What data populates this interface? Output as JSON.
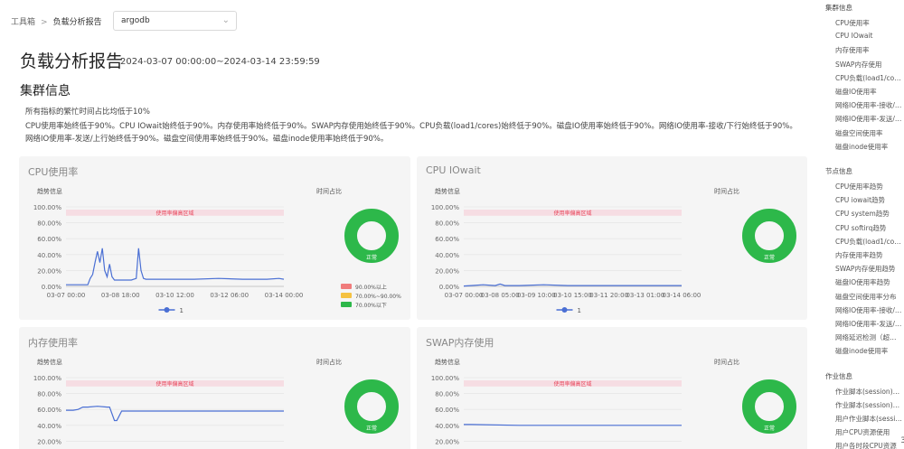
{
  "breadcrumb": {
    "root": "工具箱",
    "separator": ">",
    "current": "负载分析报告"
  },
  "cluster_select": {
    "value": "argodb"
  },
  "header": {
    "title": "负载分析报告",
    "time_range": "2024-03-07 00:00:00~2024-03-14 23:59:59"
  },
  "cluster_section": {
    "title": "集群信息",
    "summary": "所有指标的繁忙时间占比均低于10%",
    "detail": "CPU使用率始终低于90%。CPU IOwait始终低于90%。内存使用率始终低于90%。SWAP内存使用始终低于90%。CPU负载(load1/cores)始终低于90%。磁盘IO使用率始终低于90%。网络IO使用率-接收/下行始终低于90%。网络IO使用率-发送/上行始终低于90%。磁盘空间使用率始终低于90%。磁盘inode使用率始终低于90%。"
  },
  "chart_labels": {
    "trend": "趋势信息",
    "time_share": "时间占比",
    "band": "使用率偏高区域",
    "donut": "正常",
    "legend_series": "1",
    "pie_legend": [
      "90.00%以上",
      "70.00%~90.00%",
      "70.00%以下"
    ],
    "colors": {
      "high": "#f07c7c",
      "mid": "#f5c242",
      "normal": "#2db84a",
      "line": "#4a6fd4",
      "band": "#f6dde3",
      "band_text": "#e8455a"
    }
  },
  "chart_data": [
    {
      "type": "line",
      "title": "CPU使用率",
      "yticks": [
        "0.00%",
        "20.00%",
        "40.00%",
        "60.00%",
        "80.00%",
        "100.00%"
      ],
      "ylim": [
        0,
        100
      ],
      "xticks": [
        "03-07 00:00",
        "03-08 18:00",
        "03-10 12:00",
        "03-12 06:00",
        "03-14 00:00"
      ],
      "xrange_hours": [
        -6,
        174
      ],
      "band": [
        90,
        100
      ],
      "series": [
        {
          "name": "1",
          "x_hours": [
            -6,
            0,
            12,
            14,
            16,
            18,
            20,
            22,
            24,
            26,
            28,
            30,
            32,
            34,
            36,
            38,
            40,
            42,
            44,
            46,
            48,
            50,
            52,
            54,
            56,
            58,
            60,
            62,
            64,
            66,
            70,
            80,
            100,
            120,
            140,
            160,
            170,
            174
          ],
          "y": [
            2,
            2,
            2,
            10,
            15,
            30,
            44,
            30,
            48,
            20,
            12,
            28,
            12,
            8,
            8,
            8,
            8,
            8,
            8,
            8,
            8,
            9,
            10,
            48,
            20,
            10,
            9,
            9,
            9,
            9,
            9,
            9,
            9,
            10,
            9,
            9,
            10,
            9
          ]
        }
      ],
      "pie": [
        {
          "label": "90.00%以上",
          "value": 0
        },
        {
          "label": "70.00%~90.00%",
          "value": 0
        },
        {
          "label": "70.00%以下",
          "value": 100
        }
      ],
      "show_pie_legend": true
    },
    {
      "type": "line",
      "title": "CPU IOwait",
      "yticks": [
        "0.00%",
        "20.00%",
        "40.00%",
        "60.00%",
        "80.00%",
        "100.00%"
      ],
      "ylim": [
        0,
        100
      ],
      "xticks": [
        "03-07 00:00",
        "03-08 05:00",
        "03-09 10:00",
        "03-10 15:00",
        "03-11 20:00",
        "03-13 01:00",
        "03-14 06:00"
      ],
      "xrange_hours": [
        -6,
        174
      ],
      "band": [
        90,
        100
      ],
      "series": [
        {
          "name": "1",
          "x_hours": [
            -6,
            0,
            10,
            20,
            24,
            28,
            30,
            40,
            60,
            80,
            100,
            120,
            140,
            160,
            174
          ],
          "y": [
            0.5,
            1,
            2,
            1,
            3,
            1,
            1,
            1,
            2,
            1,
            1,
            1,
            1,
            1,
            1
          ]
        }
      ],
      "pie": [
        {
          "label": "70.00%以下",
          "value": 100
        }
      ],
      "show_pie_legend": false
    },
    {
      "type": "line",
      "title": "内存使用率",
      "yticks": [
        "20.00%",
        "40.00%",
        "60.00%",
        "80.00%",
        "100.00%"
      ],
      "ylim": [
        0,
        100
      ],
      "xticks": [],
      "xrange_hours": [
        -6,
        174
      ],
      "band": [
        90,
        100
      ],
      "series": [
        {
          "name": "1",
          "x_hours": [
            -6,
            0,
            4,
            8,
            12,
            20,
            28,
            30,
            34,
            36,
            40,
            44,
            48,
            60,
            80,
            100,
            120,
            140,
            160,
            174
          ],
          "y": [
            59,
            59,
            60,
            63,
            63,
            64,
            63,
            63,
            46,
            46,
            58,
            58,
            58,
            58,
            58,
            58,
            58,
            58,
            58,
            58
          ]
        }
      ],
      "pie": [
        {
          "label": "70.00%以下",
          "value": 100
        }
      ],
      "show_pie_legend": false
    },
    {
      "type": "line",
      "title": "SWAP内存使用",
      "yticks": [
        "20.00%",
        "40.00%",
        "60.00%",
        "80.00%",
        "100.00%"
      ],
      "ylim": [
        0,
        100
      ],
      "xticks": [],
      "xrange_hours": [
        -6,
        174
      ],
      "band": [
        90,
        100
      ],
      "series": [
        {
          "name": "1",
          "x_hours": [
            -6,
            0,
            40,
            80,
            120,
            174
          ],
          "y": [
            41,
            41,
            40,
            40,
            40,
            40
          ]
        }
      ],
      "pie": [
        {
          "label": "70.00%以下",
          "value": 100
        }
      ],
      "show_pie_legend": false
    }
  ],
  "sidebar": {
    "groups": [
      {
        "title": "集群信息",
        "items": [
          "CPU使用率",
          "CPU IOwait",
          "内存使用率",
          "SWAP内存使用",
          "CPU负载(load1/cores)",
          "磁盘IO使用率",
          "网络IO使用率-接收/下行",
          "网络IO使用率-发送/上行",
          "磁盘空间使用率",
          "磁盘inode使用率"
        ]
      },
      {
        "title": "节点信息",
        "items": [
          "CPU使用率趋势",
          "CPU iowait趋势",
          "CPU system趋势",
          "CPU softirq趋势",
          "CPU负载(load1/cores)",
          "内存使用率趋势",
          "SWAP内存使用趋势",
          "磁盘IO使用率趋势",
          "磁盘空间使用率分布",
          "网络IO使用率-接收/下行",
          "网络IO使用率-发送/上行",
          "网络延迟检测（超时）",
          "磁盘inode使用率"
        ]
      },
      {
        "title": "作业信息",
        "items": [
          "作业脚本(session)分布",
          "作业脚本(session)分布",
          "用户作业脚本(session)",
          "用户CPU资源使用",
          "用户各时段CPU资源"
        ]
      }
    ],
    "scroll_indicator": "3"
  }
}
